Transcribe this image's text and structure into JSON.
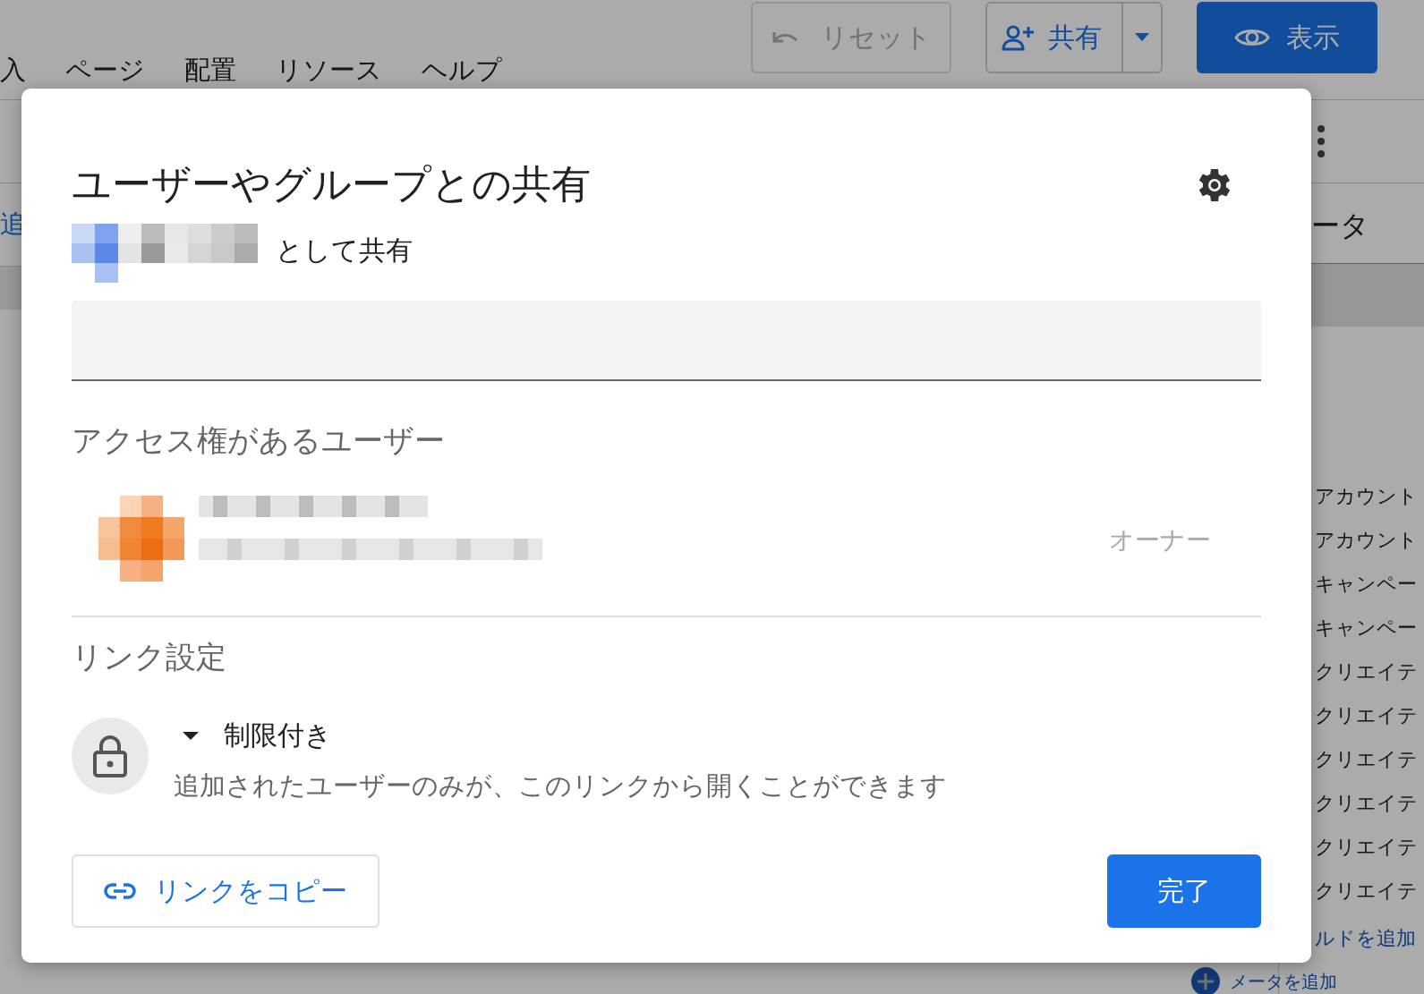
{
  "toolbar": {
    "menu": [
      "入",
      "ページ",
      "配置",
      "リソース",
      "ヘルプ"
    ],
    "reset_button": {
      "label": "リセット",
      "disabled": true
    },
    "share_button": "共有",
    "view_button": "表示"
  },
  "left_edge": {
    "link": "追"
  },
  "side_panel": {
    "title": "ータ",
    "items": [
      "アカウント",
      "アカウント",
      "キャンペー",
      "キャンペー",
      "クリエイテ",
      "クリエイテ",
      "クリエイテ",
      "クリエイテ",
      "クリエイテ",
      "クリエイテ"
    ],
    "add_field": "ルドを追加",
    "add_parameter": "メータを追加"
  },
  "dialog": {
    "title": "ユーザーやグループとの共有",
    "sharing_as_suffix": "として共有",
    "people_heading": "アクセス権があるユーザー",
    "people": [
      {
        "role": "オーナー"
      }
    ],
    "link_heading": "リンク設定",
    "link_access": "制限付き",
    "link_description": "追加されたユーザーのみが、このリンクから開くことができます",
    "copy_link_button": "リンクをコピー",
    "done_button": "完了"
  }
}
